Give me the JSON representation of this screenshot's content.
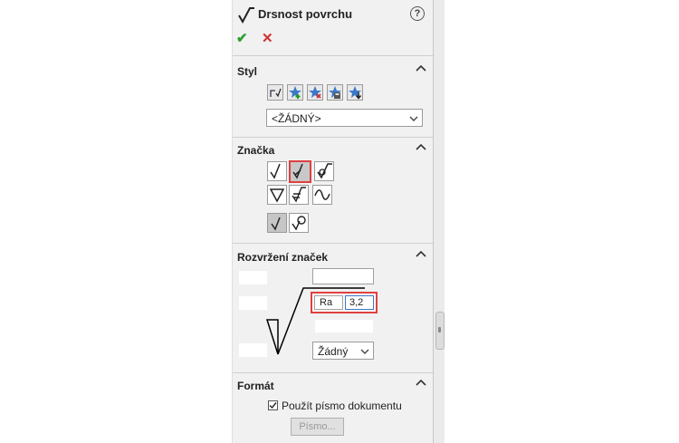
{
  "title": "Drsnost povrchu",
  "help_glyph": "?",
  "confirm_glyph": "✔",
  "cancel_glyph": "✕",
  "styl": {
    "header": "Styl",
    "dropdown_value": "<ŽÁDNÝ>"
  },
  "znacka": {
    "header": "Značka"
  },
  "rozvrzeni": {
    "header": "Rozvržení značek",
    "ra_label": "Ra",
    "ra_value": "3,2",
    "direction_value": "Žádný"
  },
  "format": {
    "header": "Formát",
    "checkbox_label": "Použít písmo dokumentu",
    "checkbox_checked": true,
    "font_button": "Písmo..."
  },
  "colors": {
    "confirm": "#2e9e2e",
    "cancel": "#d03030",
    "highlight": "#e04040"
  }
}
